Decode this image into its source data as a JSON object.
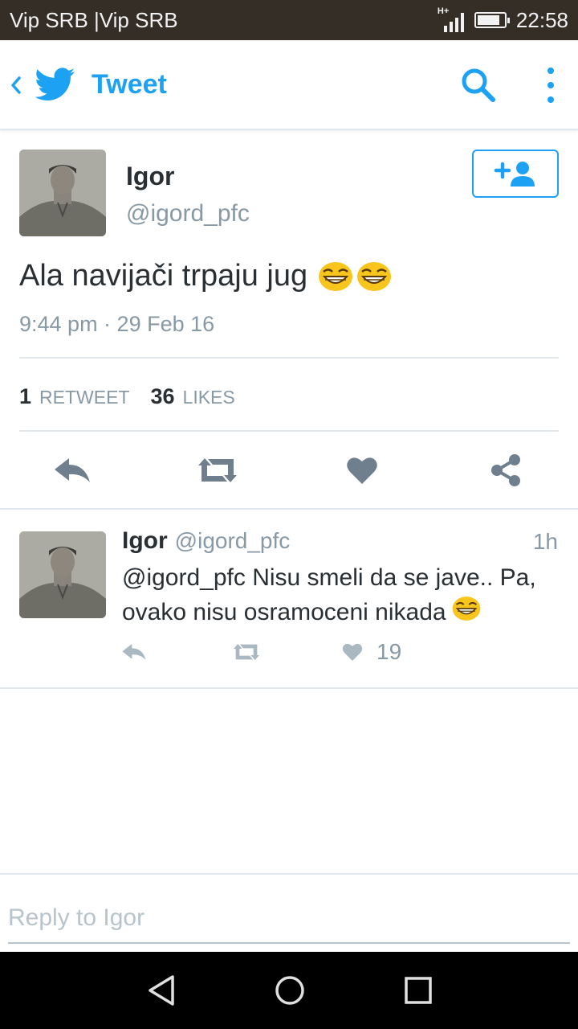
{
  "status_bar": {
    "carrier": "Vip SRB |Vip SRB",
    "network": "H+",
    "time": "22:58",
    "battery_level": 0.85,
    "background": "#352e27"
  },
  "toolbar": {
    "title": "Tweet",
    "accent": "#1da1f2",
    "icons": [
      "back-chevron-icon",
      "twitter-bird-icon",
      "search-icon",
      "more-vertical-icon"
    ]
  },
  "tweet": {
    "author_name": "Igor",
    "author_handle": "@igord_pfc",
    "text": "Ala navijači trpaju jug",
    "emojis": [
      "😂",
      "😂"
    ],
    "time": "9:44 pm · 29 Feb 16",
    "retweets": "1",
    "retweets_label": "RETWEET",
    "likes": "36",
    "likes_label": "LIKES",
    "actions": [
      "reply-icon",
      "retweet-icon",
      "heart-icon",
      "share-icon"
    ]
  },
  "reply": {
    "author_name": "Igor",
    "author_handle": "@igord_pfc",
    "age": "1h",
    "text": "@igord_pfc Nisu smeli da se jave.. Pa, ovako nisu osramoceni nikada",
    "emoji": "😂",
    "like_count": "19"
  },
  "composer": {
    "placeholder": "Reply to Igor",
    "value": ""
  },
  "navbar": {
    "icons": [
      "back-triangle-icon",
      "home-circle-icon",
      "recents-square-icon"
    ]
  }
}
